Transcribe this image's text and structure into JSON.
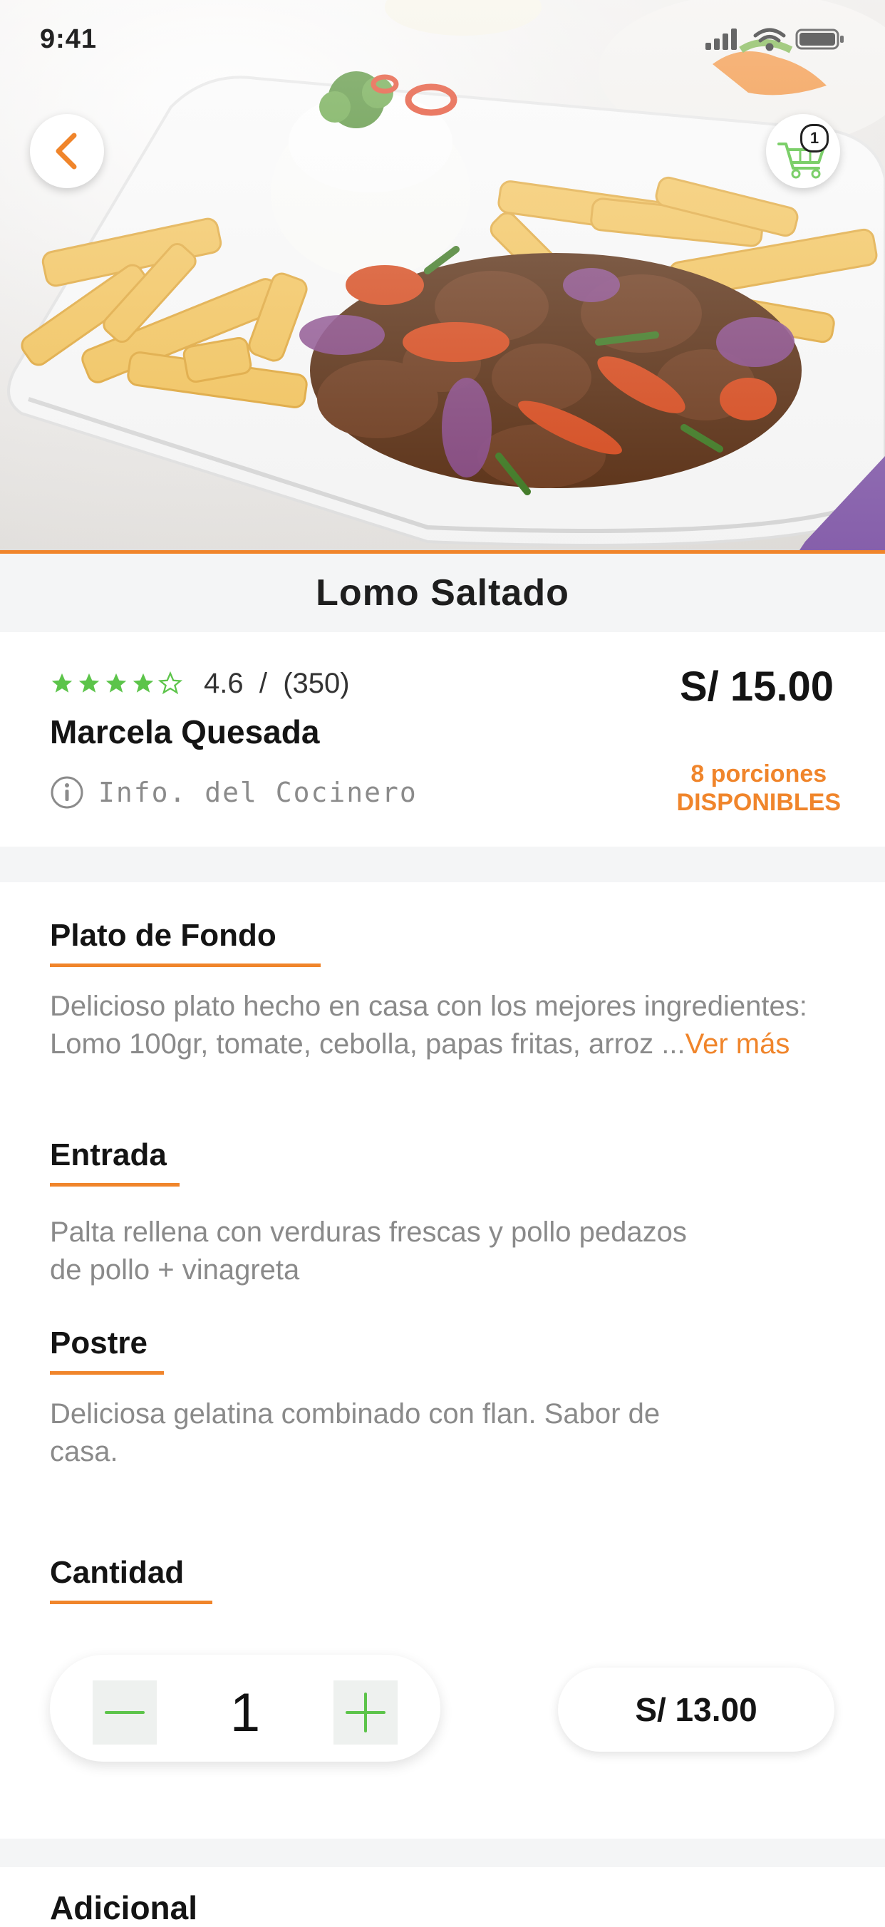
{
  "status_bar": {
    "time": "9:41"
  },
  "header": {
    "cart_count": "1"
  },
  "dish": {
    "title": "Lomo Saltado",
    "rating": "4.6",
    "rating_sep": "/",
    "reviews": "(350)",
    "stars_filled": 4,
    "stars_total": 5,
    "chef_name": "Marcela Quesada",
    "chef_info_label": "Info. del Cocinero",
    "price": "S/ 15.00",
    "portions_line1": "8 porciones",
    "portions_line2": "DISPONIBLES"
  },
  "sections": [
    {
      "title": "Plato de Fondo",
      "text": "Delicioso plato hecho en casa con los mejores ingredientes: Lomo 100gr, tomate, cebolla, papas fritas, arroz ...",
      "more": "Ver más"
    },
    {
      "title": "Entrada",
      "text": "Palta rellena con verduras frescas y pollo pedazos de pollo + vinagreta"
    },
    {
      "title": "Postre",
      "text": "Deliciosa gelatina combinado con flan. Sabor de casa."
    }
  ],
  "quantity": {
    "title": "Cantidad",
    "value": "1",
    "total": "S/ 13.00"
  },
  "next_section": {
    "title": "Adicional"
  },
  "colors": {
    "accent": "#f0852b",
    "star_green": "#5cc44a",
    "plus_green": "#5cc44a"
  },
  "icons": [
    "back-icon",
    "cart-icon",
    "info-icon",
    "star-icon",
    "minus-icon",
    "plus-icon",
    "signal-icon",
    "wifi-icon",
    "battery-icon"
  ]
}
